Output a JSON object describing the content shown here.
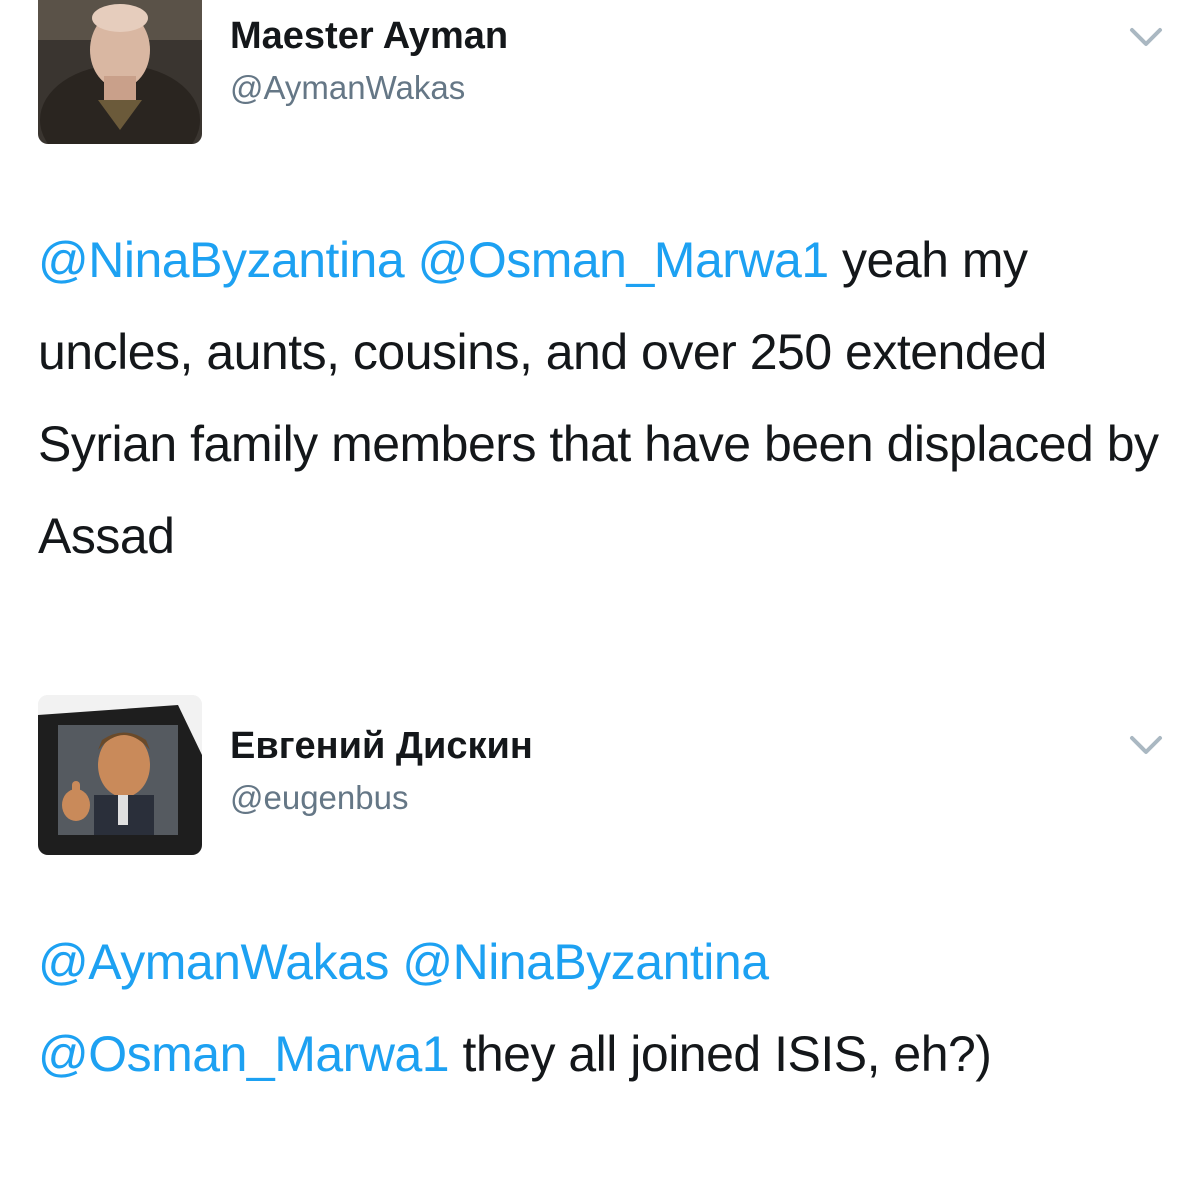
{
  "tweets": [
    {
      "display_name": "Maester Ayman",
      "handle": "@AymanWakas",
      "avatar_icon": "avatar-elderly-man-photo",
      "menu_icon": "chevron-down-icon",
      "mentions": [
        "@NinaByzantina",
        "@Osman_Marwa1"
      ],
      "text": "yeah my uncles, aunts, cousins, and over 250 extended Syrian family members that have been displaced by Assad"
    },
    {
      "display_name": "Евгений Дискин",
      "handle": "@eugenbus",
      "avatar_icon": "avatar-thumbs-up-car-photo",
      "menu_icon": "chevron-down-icon",
      "mentions": [
        "@AymanWakas",
        "@NinaByzantina",
        "@Osman_Marwa1"
      ],
      "text": "they all joined ISIS, eh?)"
    }
  ],
  "colors": {
    "mention": "#1da1f2",
    "text": "#14171a",
    "handle": "#657786",
    "chevron": "#aab8c2"
  }
}
